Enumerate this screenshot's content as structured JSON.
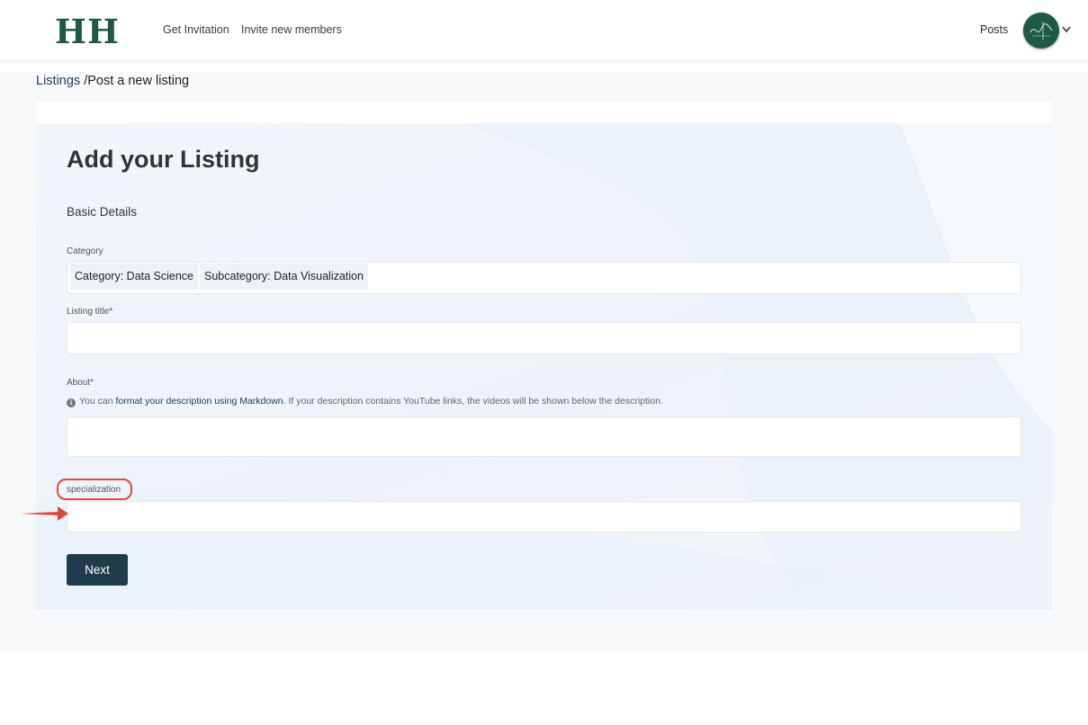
{
  "header": {
    "logo_text": "HH",
    "nav": [
      {
        "label": "Get Invitation"
      },
      {
        "label": "Invite new members"
      }
    ],
    "posts_label": "Posts",
    "brand_color": "#1f5a44"
  },
  "breadcrumb": {
    "parent": "Listings",
    "separator": " /",
    "current": "Post a new listing"
  },
  "form": {
    "title": "Add your Listing",
    "section": "Basic Details",
    "category": {
      "label": "Category",
      "chips": [
        {
          "text": "Category: Data Science"
        },
        {
          "text": "Subcategory: Data Visualization"
        }
      ]
    },
    "listing_title": {
      "label": "Listing title*",
      "value": ""
    },
    "about": {
      "label": "About*",
      "hint_prefix": "You can ",
      "hint_link": "format your description using Markdown",
      "hint_suffix": ". If your description contains YouTube links, the videos will be shown below the description.",
      "value": ""
    },
    "specialization": {
      "label": "specialization",
      "value": ""
    },
    "next_label": "Next"
  },
  "annotation": {
    "highlight_color": "#e0483a",
    "icons": [
      "info-icon",
      "chevron-down-icon",
      "arrow-right-icon"
    ]
  }
}
